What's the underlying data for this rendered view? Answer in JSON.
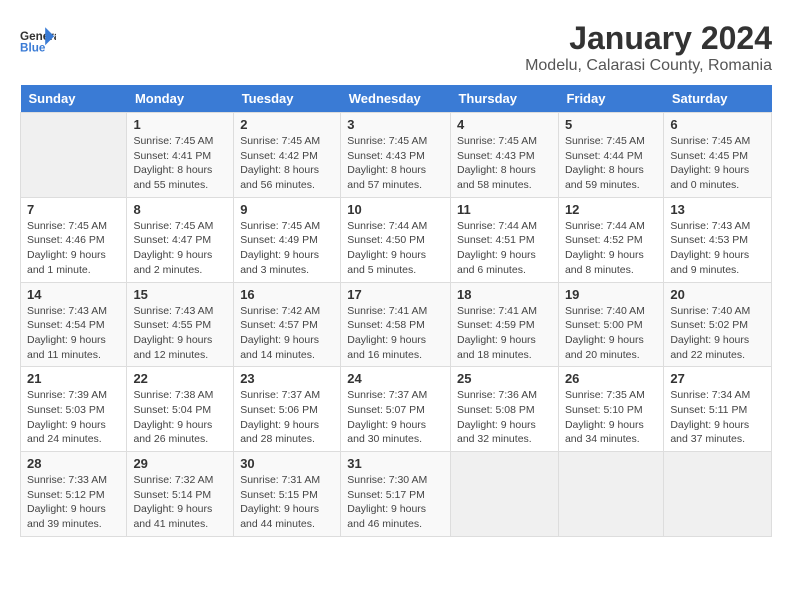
{
  "header": {
    "logo_line1": "General",
    "logo_line2": "Blue",
    "title": "January 2024",
    "subtitle": "Modelu, Calarasi County, Romania"
  },
  "weekdays": [
    "Sunday",
    "Monday",
    "Tuesday",
    "Wednesday",
    "Thursday",
    "Friday",
    "Saturday"
  ],
  "weeks": [
    [
      {
        "day": "",
        "info": ""
      },
      {
        "day": "1",
        "info": "Sunrise: 7:45 AM\nSunset: 4:41 PM\nDaylight: 8 hours and 55 minutes."
      },
      {
        "day": "2",
        "info": "Sunrise: 7:45 AM\nSunset: 4:42 PM\nDaylight: 8 hours and 56 minutes."
      },
      {
        "day": "3",
        "info": "Sunrise: 7:45 AM\nSunset: 4:43 PM\nDaylight: 8 hours and 57 minutes."
      },
      {
        "day": "4",
        "info": "Sunrise: 7:45 AM\nSunset: 4:43 PM\nDaylight: 8 hours and 58 minutes."
      },
      {
        "day": "5",
        "info": "Sunrise: 7:45 AM\nSunset: 4:44 PM\nDaylight: 8 hours and 59 minutes."
      },
      {
        "day": "6",
        "info": "Sunrise: 7:45 AM\nSunset: 4:45 PM\nDaylight: 9 hours and 0 minutes."
      }
    ],
    [
      {
        "day": "7",
        "info": "Sunrise: 7:45 AM\nSunset: 4:46 PM\nDaylight: 9 hours and 1 minute."
      },
      {
        "day": "8",
        "info": "Sunrise: 7:45 AM\nSunset: 4:47 PM\nDaylight: 9 hours and 2 minutes."
      },
      {
        "day": "9",
        "info": "Sunrise: 7:45 AM\nSunset: 4:49 PM\nDaylight: 9 hours and 3 minutes."
      },
      {
        "day": "10",
        "info": "Sunrise: 7:44 AM\nSunset: 4:50 PM\nDaylight: 9 hours and 5 minutes."
      },
      {
        "day": "11",
        "info": "Sunrise: 7:44 AM\nSunset: 4:51 PM\nDaylight: 9 hours and 6 minutes."
      },
      {
        "day": "12",
        "info": "Sunrise: 7:44 AM\nSunset: 4:52 PM\nDaylight: 9 hours and 8 minutes."
      },
      {
        "day": "13",
        "info": "Sunrise: 7:43 AM\nSunset: 4:53 PM\nDaylight: 9 hours and 9 minutes."
      }
    ],
    [
      {
        "day": "14",
        "info": "Sunrise: 7:43 AM\nSunset: 4:54 PM\nDaylight: 9 hours and 11 minutes."
      },
      {
        "day": "15",
        "info": "Sunrise: 7:43 AM\nSunset: 4:55 PM\nDaylight: 9 hours and 12 minutes."
      },
      {
        "day": "16",
        "info": "Sunrise: 7:42 AM\nSunset: 4:57 PM\nDaylight: 9 hours and 14 minutes."
      },
      {
        "day": "17",
        "info": "Sunrise: 7:41 AM\nSunset: 4:58 PM\nDaylight: 9 hours and 16 minutes."
      },
      {
        "day": "18",
        "info": "Sunrise: 7:41 AM\nSunset: 4:59 PM\nDaylight: 9 hours and 18 minutes."
      },
      {
        "day": "19",
        "info": "Sunrise: 7:40 AM\nSunset: 5:00 PM\nDaylight: 9 hours and 20 minutes."
      },
      {
        "day": "20",
        "info": "Sunrise: 7:40 AM\nSunset: 5:02 PM\nDaylight: 9 hours and 22 minutes."
      }
    ],
    [
      {
        "day": "21",
        "info": "Sunrise: 7:39 AM\nSunset: 5:03 PM\nDaylight: 9 hours and 24 minutes."
      },
      {
        "day": "22",
        "info": "Sunrise: 7:38 AM\nSunset: 5:04 PM\nDaylight: 9 hours and 26 minutes."
      },
      {
        "day": "23",
        "info": "Sunrise: 7:37 AM\nSunset: 5:06 PM\nDaylight: 9 hours and 28 minutes."
      },
      {
        "day": "24",
        "info": "Sunrise: 7:37 AM\nSunset: 5:07 PM\nDaylight: 9 hours and 30 minutes."
      },
      {
        "day": "25",
        "info": "Sunrise: 7:36 AM\nSunset: 5:08 PM\nDaylight: 9 hours and 32 minutes."
      },
      {
        "day": "26",
        "info": "Sunrise: 7:35 AM\nSunset: 5:10 PM\nDaylight: 9 hours and 34 minutes."
      },
      {
        "day": "27",
        "info": "Sunrise: 7:34 AM\nSunset: 5:11 PM\nDaylight: 9 hours and 37 minutes."
      }
    ],
    [
      {
        "day": "28",
        "info": "Sunrise: 7:33 AM\nSunset: 5:12 PM\nDaylight: 9 hours and 39 minutes."
      },
      {
        "day": "29",
        "info": "Sunrise: 7:32 AM\nSunset: 5:14 PM\nDaylight: 9 hours and 41 minutes."
      },
      {
        "day": "30",
        "info": "Sunrise: 7:31 AM\nSunset: 5:15 PM\nDaylight: 9 hours and 44 minutes."
      },
      {
        "day": "31",
        "info": "Sunrise: 7:30 AM\nSunset: 5:17 PM\nDaylight: 9 hours and 46 minutes."
      },
      {
        "day": "",
        "info": ""
      },
      {
        "day": "",
        "info": ""
      },
      {
        "day": "",
        "info": ""
      }
    ]
  ]
}
